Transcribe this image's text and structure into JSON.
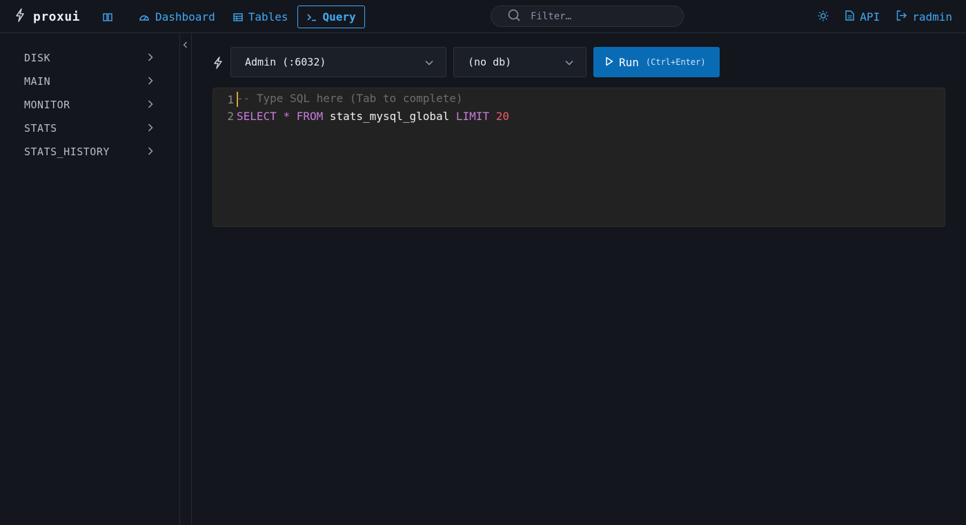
{
  "app": {
    "name": "proxui"
  },
  "nav": {
    "items": [
      {
        "label": "Dashboard"
      },
      {
        "label": "Tables"
      },
      {
        "label": "Query"
      }
    ]
  },
  "search": {
    "placeholder": "Filter…"
  },
  "tools": {
    "api_label": "API",
    "user_label": "radmin"
  },
  "sidebar": {
    "items": [
      {
        "label": "DISK"
      },
      {
        "label": "MAIN"
      },
      {
        "label": "MONITOR"
      },
      {
        "label": "STATS"
      },
      {
        "label": "STATS_HISTORY"
      }
    ]
  },
  "query": {
    "connection_value": "Admin (:6032)",
    "database_value": "(no db)",
    "run_label": "Run",
    "run_hint": "(Ctrl+Enter)",
    "editor_lines": [
      {
        "number": "1",
        "tokens": [
          {
            "text": "-- Type SQL here (Tab to complete)",
            "type": "comment"
          }
        ]
      },
      {
        "number": "2",
        "tokens": [
          {
            "text": "SELECT",
            "type": "kw"
          },
          {
            "text": " ",
            "type": "id"
          },
          {
            "text": "*",
            "type": "op"
          },
          {
            "text": " ",
            "type": "id"
          },
          {
            "text": "FROM",
            "type": "kw"
          },
          {
            "text": " stats_mysql_global ",
            "type": "id"
          },
          {
            "text": "LIMIT",
            "type": "kw"
          },
          {
            "text": " ",
            "type": "id"
          },
          {
            "text": "20",
            "type": "num"
          }
        ]
      }
    ]
  },
  "colors": {
    "accent": "#3fa9f5",
    "run_button": "#0a6bb5",
    "background": "#13161d",
    "editor_background": "#222222"
  },
  "icons": {
    "brand": "bolt-icon",
    "layout": "layout-columns-icon",
    "dashboard": "gauge-icon",
    "tables": "table-icon",
    "query": "terminal-icon",
    "search": "search-icon",
    "theme": "sun-icon",
    "api": "document-icon",
    "logout": "logout-icon"
  }
}
